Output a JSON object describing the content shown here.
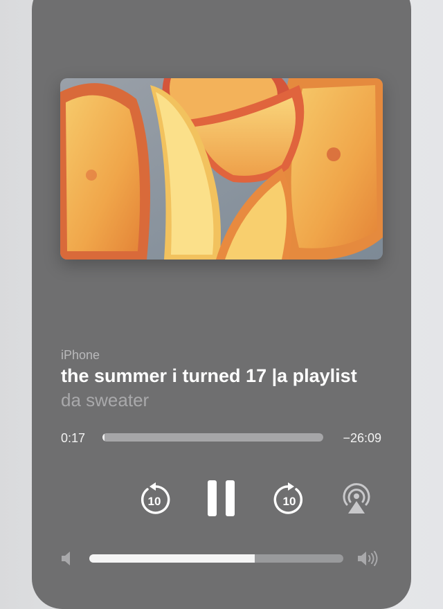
{
  "player": {
    "source_label": "iPhone",
    "title": "the summer i turned 17 |a playlist",
    "artist": "da sweater",
    "artwork_icon": "peach-slices-artwork",
    "elapsed": "0:17",
    "remaining": "−26:09",
    "progress_fraction": 0.01,
    "skip_back_label": "10",
    "skip_forward_label": "10",
    "volume_fraction": 0.65
  },
  "icons": {
    "skip_back": "skip-back-10-icon",
    "pause": "pause-icon",
    "skip_forward": "skip-forward-10-icon",
    "airplay": "airplay-audio-icon",
    "volume_low": "volume-low-icon",
    "volume_high": "volume-high-icon"
  },
  "colors": {
    "card": "#6f6f70",
    "title": "#ffffff",
    "secondary": "#a9a9ab",
    "track": "#a6a6a8",
    "fill": "#ededed"
  }
}
